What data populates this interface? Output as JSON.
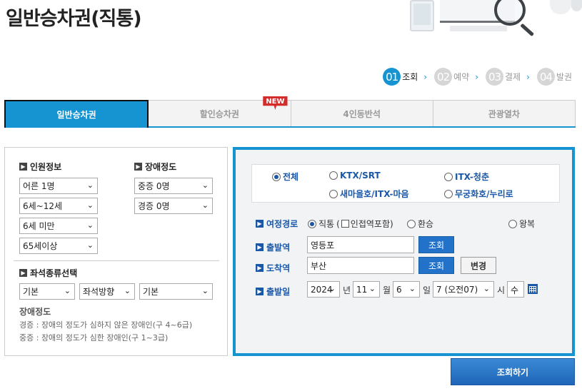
{
  "page": {
    "title": "일반승차권(직통)"
  },
  "steps": [
    {
      "num": "01",
      "label": "조회"
    },
    {
      "num": "02",
      "label": "예약"
    },
    {
      "num": "03",
      "label": "결제"
    },
    {
      "num": "04",
      "label": "발권"
    }
  ],
  "step_arrow": "›",
  "tabs": [
    {
      "label": "일반승차권"
    },
    {
      "label": "할인승차권",
      "badge": "NEW"
    },
    {
      "label": "4인동반석"
    },
    {
      "label": "관광열차"
    }
  ],
  "passenger": {
    "heading": "인원정보",
    "selects": [
      "어른 1명",
      "6세~12세",
      "6세 미만",
      "65세이상"
    ]
  },
  "disability": {
    "heading": "장애정도",
    "selects": [
      "중증 0명",
      "경증 0명"
    ]
  },
  "seat": {
    "heading": "좌석종류선택",
    "selects": [
      "기본",
      "좌석방향",
      "기본"
    ]
  },
  "note": {
    "title": "장애정도",
    "line1": "경증 : 장애의 정도가 심하지 않은 장애인(구 4~6급)",
    "line2": "중증 : 장애의 정도가 심한 장애인(구 1~3급)"
  },
  "train_types": {
    "all": "전체",
    "ktx": "KTX/SRT",
    "itx_cheongchun": "ITX-청춘",
    "saemaeul": "새마을호/ITX-마음",
    "mugunghwa": "무궁화호/누리로"
  },
  "route": {
    "label": "여정경로",
    "direct": "직통",
    "nearby_open": "(",
    "nearby": "인접역포함)",
    "transfer": "환승",
    "roundtrip": "왕복"
  },
  "departure": {
    "label": "출발역",
    "value": "영등포",
    "search_btn": "조회"
  },
  "arrival": {
    "label": "도착역",
    "value": "부산",
    "search_btn": "조회",
    "swap_btn": "변경"
  },
  "date": {
    "label": "출발일",
    "year": "2024",
    "year_unit": "년",
    "month": "11",
    "month_unit": "월",
    "day": "6",
    "day_unit": "일",
    "hour": "7 (오전07)",
    "hour_unit": "시",
    "weekday": "수"
  },
  "submit": {
    "label": "조회하기"
  },
  "icons": {
    "chevron": "chevron-down-icon",
    "section": "section-arrow-icon",
    "calendar": "calendar-icon"
  },
  "colors": {
    "accent": "#1694d2",
    "link_blue": "#1a57a6",
    "button_blue": "#2272c9",
    "badge_red": "#d42b2b"
  }
}
